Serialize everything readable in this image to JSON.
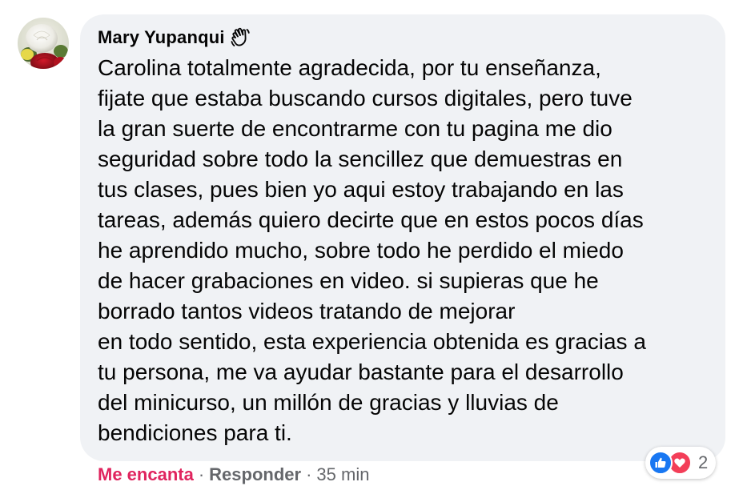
{
  "comment": {
    "author": "Mary Yupanqui",
    "author_badge_icon": "waving-hand-icon",
    "lines": [
      "Carolina totalmente agradecida, por tu enseñanza,",
      "fijate que estaba buscando cursos digitales, pero tuve",
      "la gran suerte de encontrarme con tu pagina me dio",
      "seguridad sobre todo la sencillez que demuestras en",
      "tus clases, pues bien yo aqui estoy trabajando en las",
      "tareas, además quiero decirte que en estos pocos días",
      "he aprendido mucho, sobre todo he perdido el miedo",
      "de hacer grabaciones en video. si supieras que he",
      "borrado tantos videos tratando de mejorar",
      "en todo sentido, esta experiencia obtenida es gracias a",
      "tu persona, me va ayudar bastante para el desarrollo",
      "del minicurso, un millón de gracias y lluvias de",
      "bendiciones para ti."
    ]
  },
  "actions": {
    "reaction_label": "Me encanta",
    "separator": "·",
    "reply_label": "Responder",
    "time": "35 min"
  },
  "reactions": {
    "icons": [
      "like-icon",
      "love-icon"
    ],
    "count": "2"
  },
  "colors": {
    "bubble_bg": "#f0f2f5",
    "love_red": "#e0245e",
    "like_blue": "#1877f2",
    "heart_red": "#f33e58",
    "meta_gray": "#65676b"
  }
}
